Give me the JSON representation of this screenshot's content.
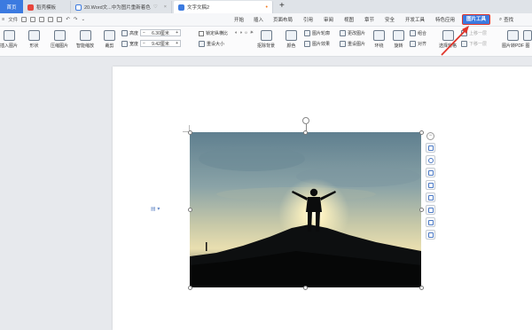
{
  "tabs": [
    {
      "label": "首页"
    },
    {
      "label": "稻壳模板"
    },
    {
      "label": "20.Word文...中为图片重新着色"
    },
    {
      "label": "文字文稿2"
    }
  ],
  "new_tab": "+",
  "quick_access": {
    "file_label": "文件"
  },
  "menu": {
    "items": [
      "开始",
      "插入",
      "页面布局",
      "引用",
      "审阅",
      "视图",
      "章节",
      "安全",
      "开发工具",
      "特色应用"
    ],
    "active": "图片工具",
    "search": "查找"
  },
  "ribbon": {
    "insert_image": "插入图片",
    "shape": "形状",
    "compress": "压缩图片",
    "smart_scale": "智能缩放",
    "crop": "裁剪",
    "height_label": "高度",
    "height_value": "6.30厘米",
    "width_label": "宽度",
    "width_value": "9.42厘米",
    "lock_ratio": "锁定纵横比",
    "reset_size": "重设大小",
    "remove_bg": "抠除背景",
    "color": "颜色",
    "image_outline": "图片轮廓",
    "image_effect": "图片效果",
    "change_image": "更改图片",
    "reset_image": "重设图片",
    "wrap": "环绕",
    "rotate": "旋转",
    "align": "对齐",
    "select_pane": "选择窗格",
    "group": "组合",
    "bring_forward": "上移一层",
    "send_backward": "下移一层",
    "to_pdf": "图片转PDF",
    "translate": "图"
  },
  "colors": {
    "accent": "#3b7ae0",
    "highlight": "#e0352b"
  }
}
